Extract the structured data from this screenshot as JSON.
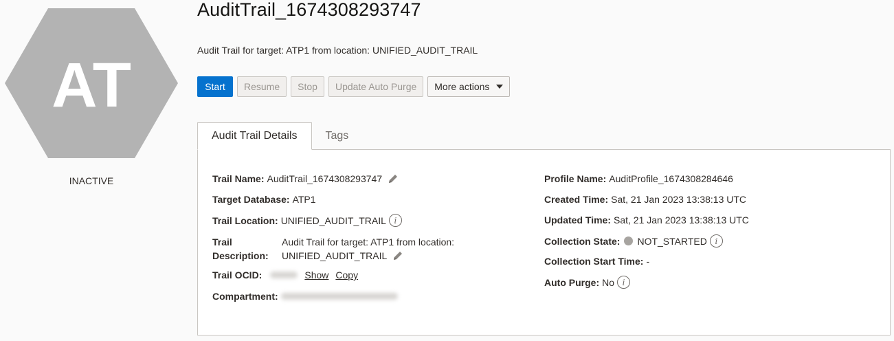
{
  "badge": {
    "initials": "AT",
    "status": "INACTIVE",
    "color": "#b3b3b3"
  },
  "header": {
    "title": "AuditTrail_1674308293747",
    "subtitle": "Audit Trail for target: ATP1 from location: UNIFIED_AUDIT_TRAIL"
  },
  "actions": {
    "start": "Start",
    "resume": "Resume",
    "stop": "Stop",
    "update_auto_purge": "Update Auto Purge",
    "more_actions": "More actions"
  },
  "tabs": [
    {
      "label": "Audit Trail Details",
      "active": true
    },
    {
      "label": "Tags",
      "active": false
    }
  ],
  "details": {
    "left": {
      "trail_name": {
        "label": "Trail Name:",
        "value": "AuditTrail_1674308293747"
      },
      "target_database": {
        "label": "Target Database:",
        "value": "ATP1"
      },
      "trail_location": {
        "label": "Trail Location:",
        "value": "UNIFIED_AUDIT_TRAIL"
      },
      "trail_description": {
        "label_line1": "Trail",
        "label_line2": "Description:",
        "value_line1": "Audit Trail for target: ATP1 from location:",
        "value_line2": "UNIFIED_AUDIT_TRAIL"
      },
      "trail_ocid": {
        "label": "Trail OCID:",
        "show": "Show",
        "copy": "Copy"
      },
      "compartment": {
        "label": "Compartment:"
      }
    },
    "right": {
      "profile_name": {
        "label": "Profile Name:",
        "value": "AuditProfile_1674308284646"
      },
      "created_time": {
        "label": "Created Time:",
        "value": "Sat, 21 Jan 2023 13:38:13 UTC"
      },
      "updated_time": {
        "label": "Updated Time:",
        "value": "Sat, 21 Jan 2023 13:38:13 UTC"
      },
      "collection_state": {
        "label": "Collection State:",
        "value": "NOT_STARTED"
      },
      "collection_start_time": {
        "label": "Collection Start Time:",
        "value": "-"
      },
      "auto_purge": {
        "label": "Auto Purge:",
        "value": "No"
      }
    }
  },
  "colors": {
    "primary": "#0572ce",
    "badge": "#b3b3b3",
    "status_dot": "#a7a4a0"
  }
}
